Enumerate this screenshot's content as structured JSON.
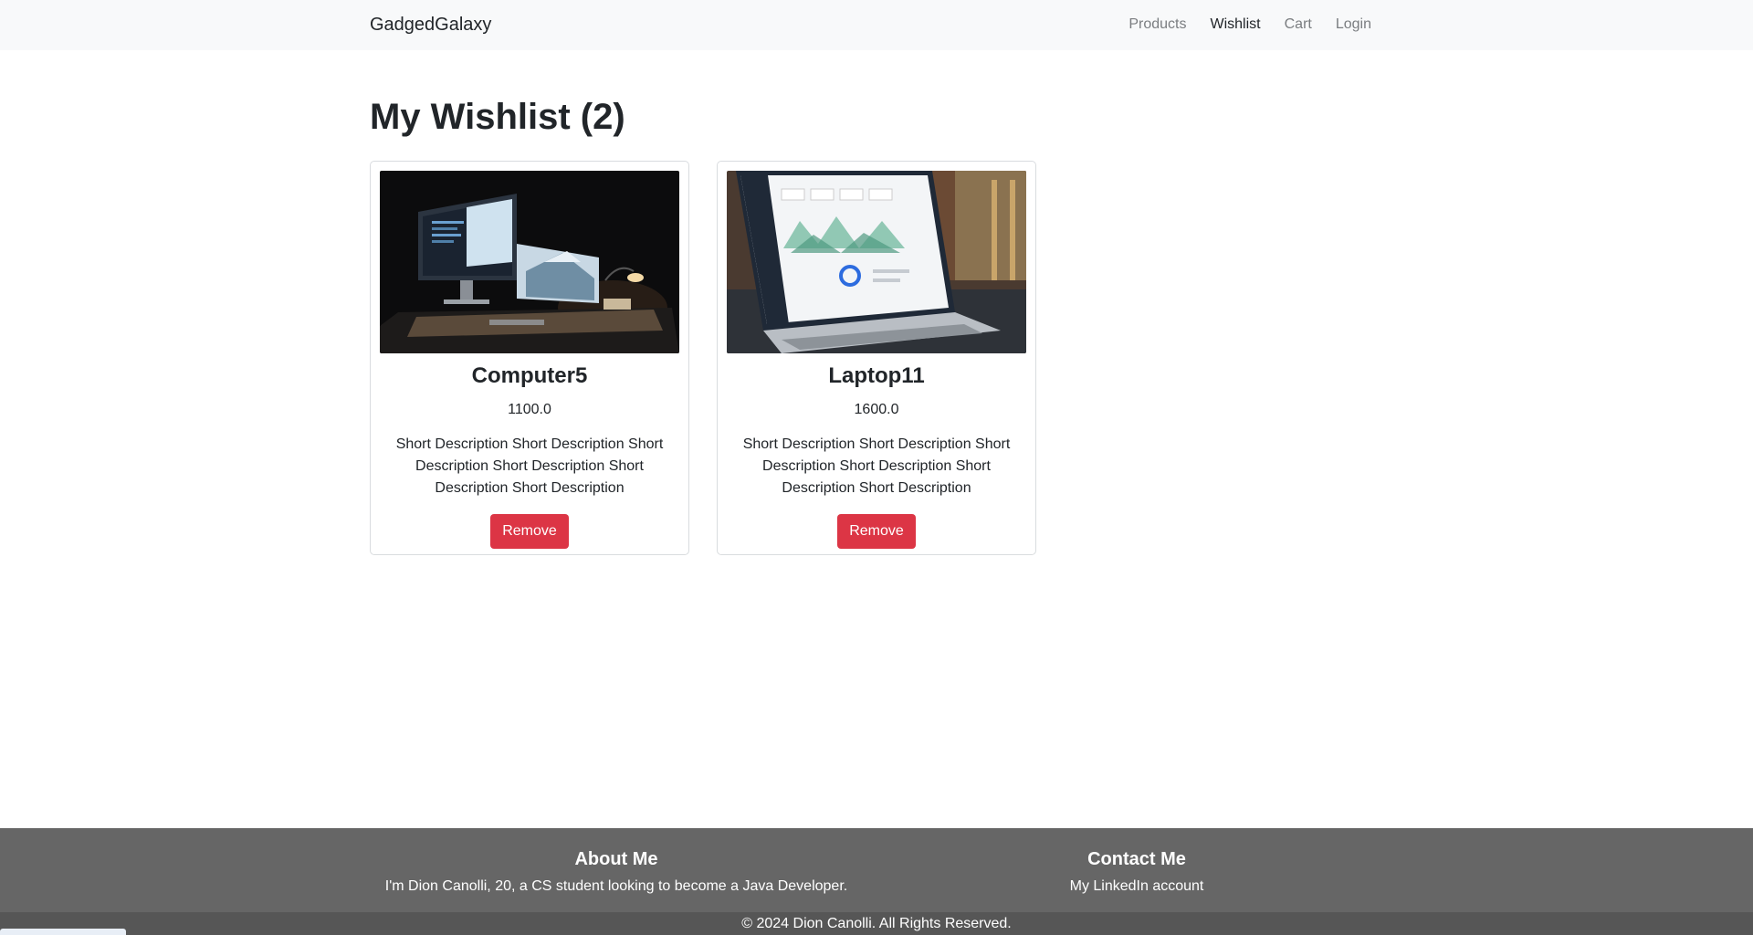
{
  "navbar": {
    "brand": "GadgedGalaxy",
    "links": [
      {
        "label": "Products",
        "active": false
      },
      {
        "label": "Wishlist",
        "active": true
      },
      {
        "label": "Cart",
        "active": false
      },
      {
        "label": "Login",
        "active": false
      }
    ]
  },
  "main": {
    "title": "My Wishlist (2)",
    "items": [
      {
        "name": "Computer5",
        "price": "1100.0",
        "description": "Short Description Short Description Short Description Short Description Short Description Short Description",
        "button_label": "Remove",
        "image": "desktop-computer-photo"
      },
      {
        "name": "Laptop11",
        "price": "1600.0",
        "description": "Short Description Short Description Short Description Short Description Short Description Short Description",
        "button_label": "Remove",
        "image": "laptop-dashboard-photo"
      }
    ]
  },
  "footer": {
    "about_heading": "About Me",
    "about_text": "I'm Dion Canolli, 20, a CS student looking to become a Java Developer.",
    "contact_heading": "Contact Me",
    "contact_link": "My LinkedIn account",
    "copyright": "© 2024 Dion Canolli. All Rights Reserved."
  },
  "colors": {
    "navbar_bg": "#f8f9fa",
    "danger": "#dc3545",
    "footer_bg": "#666666"
  }
}
